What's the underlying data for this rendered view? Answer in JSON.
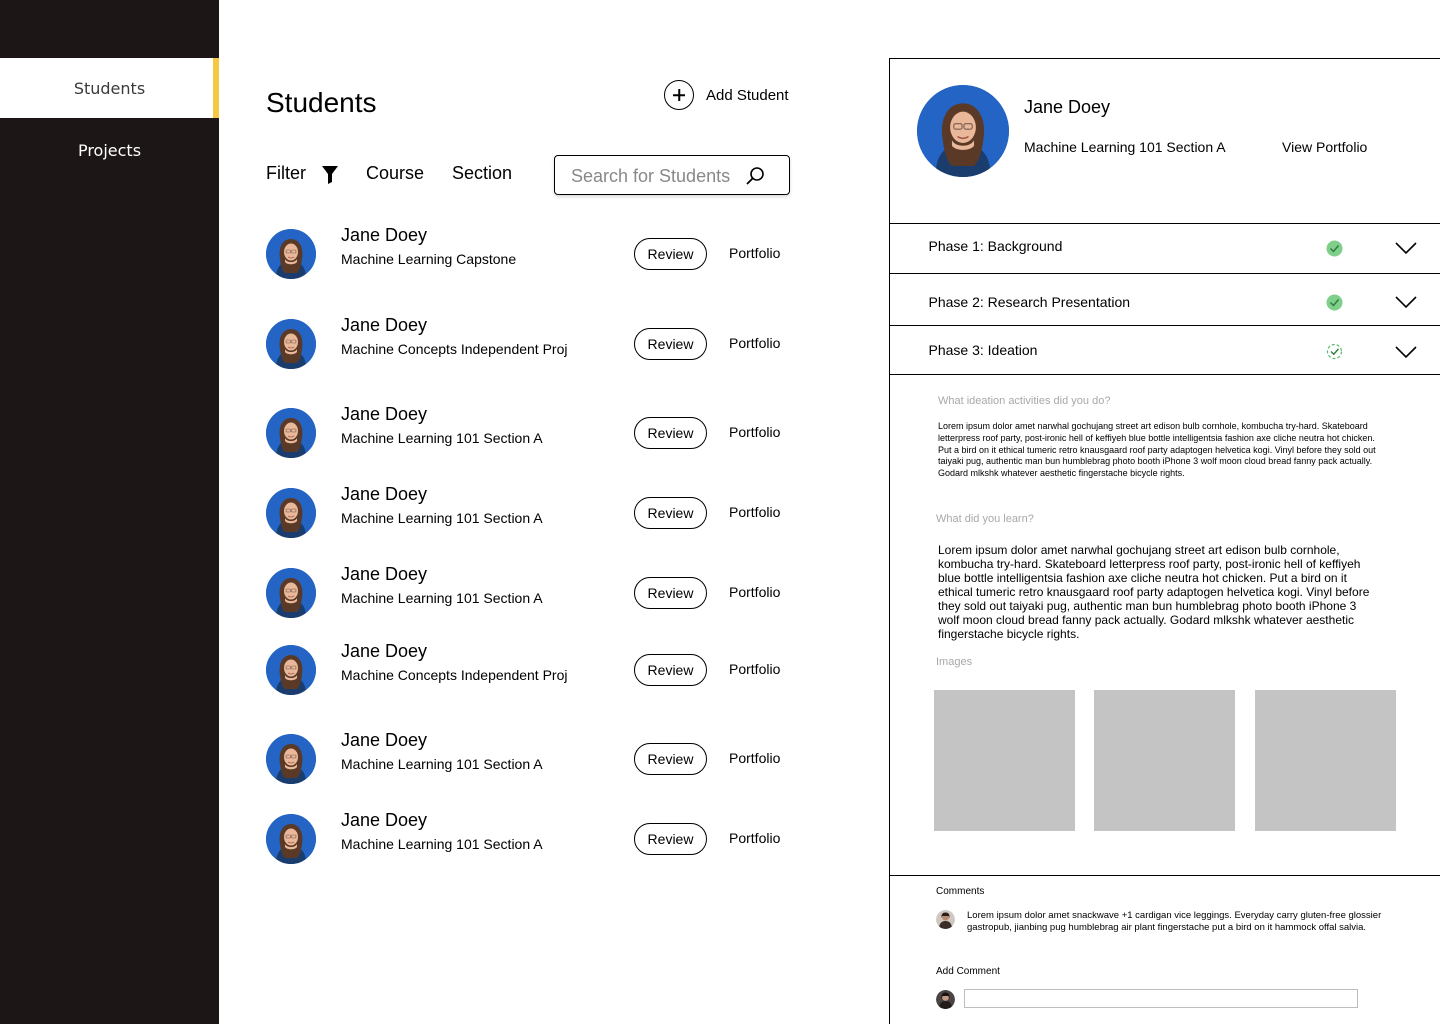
{
  "sidebar": {
    "items": [
      {
        "label": "Students",
        "active": true
      },
      {
        "label": "Projects",
        "active": false
      }
    ],
    "accent_color": "#f3c842",
    "background_color": "#1c1716"
  },
  "header": {
    "title": "Students",
    "add_label": "Add Student",
    "add_icon": "plus-circle-icon"
  },
  "filters": {
    "filter_label": "Filter",
    "filter_icon": "funnel-icon",
    "course_label": "Course",
    "section_label": "Section",
    "search_placeholder": "Search for Students",
    "search_icon": "search-icon"
  },
  "students": [
    {
      "name": "Jane Doey",
      "course": "Machine Learning Capstone",
      "review": "Review",
      "portfolio": "Portfolio"
    },
    {
      "name": "Jane Doey",
      "course": "Machine Concepts Independent Proj",
      "review": "Review",
      "portfolio": "Portfolio"
    },
    {
      "name": "Jane Doey",
      "course": "Machine Learning 101 Section A",
      "review": "Review",
      "portfolio": "Portfolio"
    },
    {
      "name": "Jane Doey",
      "course": "Machine Learning 101 Section A",
      "review": "Review",
      "portfolio": "Portfolio"
    },
    {
      "name": "Jane Doey",
      "course": "Machine Learning 101 Section A",
      "review": "Review",
      "portfolio": "Portfolio"
    },
    {
      "name": "Jane Doey",
      "course": "Machine Concepts Independent Proj",
      "review": "Review",
      "portfolio": "Portfolio"
    },
    {
      "name": "Jane Doey",
      "course": "Machine Learning 101 Section A",
      "review": "Review",
      "portfolio": "Portfolio"
    },
    {
      "name": "Jane Doey",
      "course": "Machine Learning 101 Section A",
      "review": "Review",
      "portfolio": "Portfolio"
    }
  ],
  "detail": {
    "name": "Jane Doey",
    "course": "Machine Learning 101 Section A",
    "view_portfolio": "View Portfolio",
    "phases": [
      {
        "label": "Phase 1: Background",
        "status": "complete",
        "icon": "check-circle-icon"
      },
      {
        "label": "Phase 2: Research Presentation",
        "status": "complete",
        "icon": "check-circle-icon"
      },
      {
        "label": "Phase 3: Ideation",
        "status": "in-progress",
        "icon": "progress-check-icon"
      }
    ],
    "check_color": "#7fcf8a",
    "ideation": {
      "q1": "What ideation activities did you do?",
      "a1": "Lorem ipsum dolor amet narwhal gochujang street art edison bulb cornhole, kombucha try-hard. Skateboard letterpress roof party, post-ironic hell of keffiyeh blue bottle intelligentsia fashion axe cliche neutra hot chicken. Put a bird on it ethical tumeric retro knausgaard roof party adaptogen helvetica kogi. Vinyl before they sold out taiyaki pug, authentic man bun humblebrag photo booth iPhone 3 wolf moon cloud bread fanny pack actually. Godard mlkshk whatever aesthetic fingerstache bicycle rights.",
      "q2": "What did you learn?",
      "a2": "Lorem ipsum dolor amet narwhal gochujang street art edison bulb cornhole, kombucha try-hard. Skateboard letterpress roof party, post-ironic hell of keffiyeh blue bottle intelligentsia fashion axe cliche neutra hot chicken. Put a bird on it ethical tumeric retro knausgaard roof party adaptogen helvetica kogi. Vinyl before they sold out taiyaki pug, authentic man bun humblebrag photo booth iPhone 3 wolf moon cloud bread fanny pack actually. Godard mlkshk whatever aesthetic fingerstache bicycle rights.",
      "images_label": "Images"
    },
    "comments": {
      "heading": "Comments",
      "text": "Lorem ipsum dolor amet snackwave +1 cardigan vice leggings. Everyday carry gluten-free glossier gastropub, jianbing pug humblebrag air plant fingerstache put a bird on it hammock offal salvia.",
      "add_heading": "Add Comment"
    }
  }
}
